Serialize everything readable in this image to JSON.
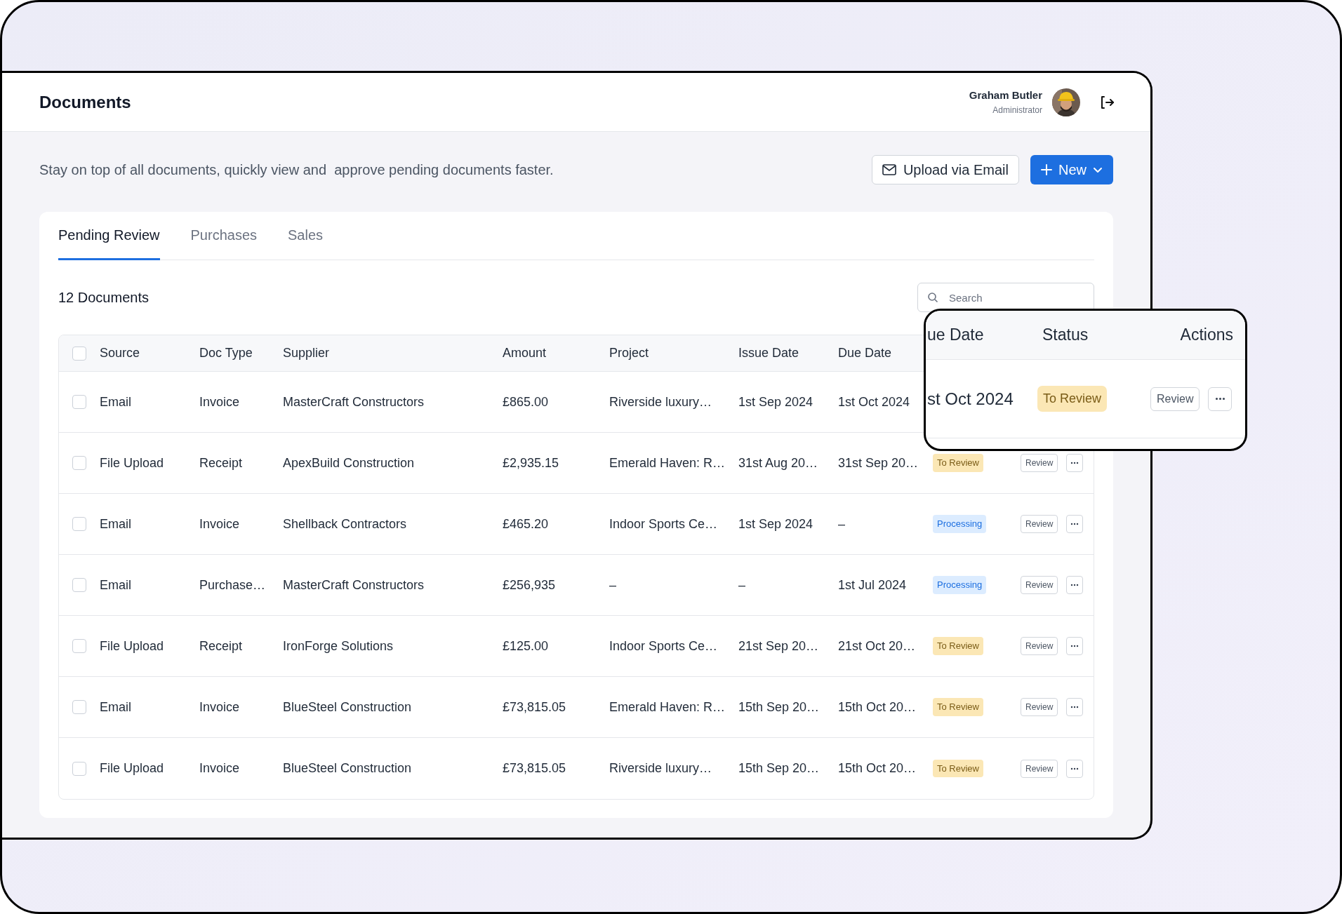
{
  "header": {
    "title": "Documents",
    "user": {
      "name": "Graham Butler",
      "role": "Administrator"
    }
  },
  "intro": "Stay on top of all documents, quickly view and  approve pending documents faster.",
  "actions": [
    {
      "label": "Upload via Email",
      "kind": "outline"
    },
    {
      "label": "New",
      "kind": "primary"
    }
  ],
  "tabs": [
    {
      "label": "Pending Review",
      "selected": true
    },
    {
      "label": "Purchases",
      "selected": false
    },
    {
      "label": "Sales",
      "selected": false
    }
  ],
  "count": "12 Documents",
  "search": {
    "placeholder": "Search"
  },
  "table": {
    "select_all_checked": false,
    "columns": [
      "Source",
      "Doc Type",
      "Supplier",
      "Amount",
      "Project",
      "Issue Date",
      "Due Date"
    ],
    "rows": [
      {
        "checked": false,
        "cells": [
          "Email",
          "Invoice",
          "MasterCraft Constructors",
          "£865.00",
          "Riverside luxury…",
          "1st Sep 2024",
          "1st Oct 2024"
        ]
      },
      {
        "checked": false,
        "cells": [
          "File Upload",
          "Receipt",
          "ApexBuild Construction",
          "£2,935.15",
          "Emerald Haven: R…",
          "31st Aug 20…",
          "31st Sep 20…"
        ],
        "status": {
          "label": "To Review",
          "kind": "to_review"
        },
        "action": "Review"
      },
      {
        "checked": false,
        "cells": [
          "Email",
          "Invoice",
          "Shellback Contractors",
          "£465.20",
          "Indoor Sports Ce…",
          "1st Sep 2024",
          "–"
        ],
        "status": {
          "label": "Processing",
          "kind": "processing"
        },
        "action": "Review"
      },
      {
        "checked": false,
        "cells": [
          "Email",
          "Purchase…",
          "MasterCraft Constructors",
          "£256,935",
          "–",
          "–",
          "1st Jul 2024"
        ],
        "status": {
          "label": "Processing",
          "kind": "processing"
        },
        "action": "Review"
      },
      {
        "checked": false,
        "cells": [
          "File Upload",
          "Receipt",
          "IronForge Solutions",
          "£125.00",
          "Indoor Sports Ce…",
          "21st Sep 20…",
          "21st Oct 20…"
        ],
        "status": {
          "label": "To Review",
          "kind": "to_review"
        },
        "action": "Review"
      },
      {
        "checked": false,
        "cells": [
          "Email",
          "Invoice",
          "BlueSteel Construction",
          "£73,815.05",
          "Emerald Haven: R…",
          "15th Sep 20…",
          "15th Oct 20…"
        ],
        "status": {
          "label": "To Review",
          "kind": "to_review"
        },
        "action": "Review"
      },
      {
        "checked": false,
        "cells": [
          "File Upload",
          "Invoice",
          "BlueSteel Construction",
          "£73,815.05",
          "Riverside luxury…",
          "15th Sep 20…",
          "15th Oct 20…"
        ],
        "status": {
          "label": "To Review",
          "kind": "to_review"
        },
        "action": "Review"
      }
    ]
  },
  "callout": {
    "columns": [
      "ue Date",
      "Status",
      "Actions"
    ],
    "row": {
      "due": "st Oct 2024",
      "status": {
        "label": "To Review",
        "kind": "to_review"
      },
      "action": "Review"
    }
  }
}
